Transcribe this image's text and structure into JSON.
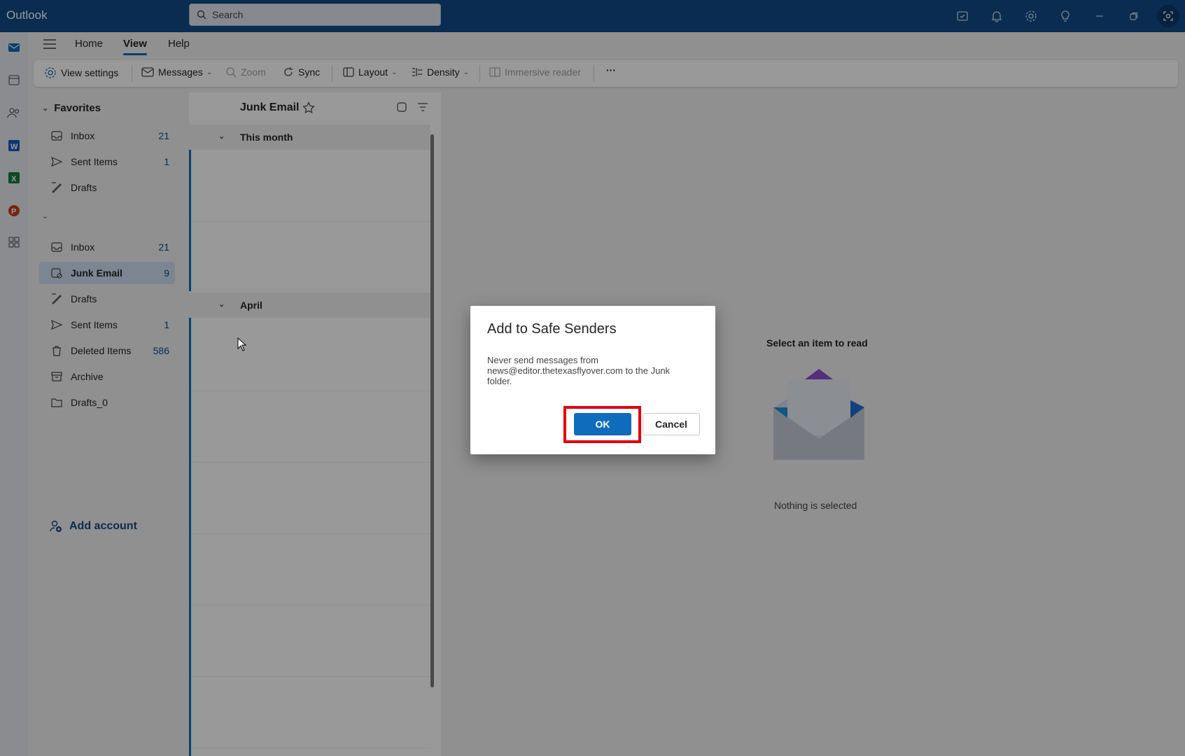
{
  "titlebar": {
    "app_name": "Outlook",
    "search_placeholder": "Search",
    "icons": [
      "my-day-icon",
      "bell-icon",
      "gear-icon",
      "lightbulb-icon",
      "minimize-icon",
      "restore-icon",
      "screen-capture-icon"
    ]
  },
  "rail": {
    "icons": [
      "mail-icon",
      "calendar-icon",
      "people-icon",
      "word-icon",
      "excel-icon",
      "powerpoint-icon",
      "apps-icon"
    ]
  },
  "tabs": [
    {
      "label": "Home"
    },
    {
      "label": "View"
    },
    {
      "label": "Help"
    }
  ],
  "ribbon": {
    "view_settings": "View settings",
    "messages": "Messages",
    "zoom": "Zoom",
    "sync": "Sync",
    "layout": "Layout",
    "density": "Density",
    "immersive_reader": "Immersive reader",
    "more": "···"
  },
  "folders": {
    "favorites_label": "Favorites",
    "favorites": [
      {
        "label": "Inbox",
        "count": "21"
      },
      {
        "label": "Sent Items",
        "count": "1"
      },
      {
        "label": "Drafts",
        "count": ""
      }
    ],
    "account": [
      {
        "label": "Inbox",
        "count": "21"
      },
      {
        "label": "Junk Email",
        "count": "9"
      },
      {
        "label": "Drafts",
        "count": ""
      },
      {
        "label": "Sent Items",
        "count": "1"
      },
      {
        "label": "Deleted Items",
        "count": "586"
      },
      {
        "label": "Archive",
        "count": ""
      },
      {
        "label": "Drafts_0",
        "count": ""
      }
    ],
    "add_account": "Add account"
  },
  "message_list": {
    "title": "Junk Email",
    "groups": [
      {
        "label": "This month"
      },
      {
        "label": "April"
      }
    ]
  },
  "reading_pane": {
    "title": "Select an item to read",
    "empty": "Nothing is selected"
  },
  "dialog": {
    "title": "Add to Safe Senders",
    "body": "Never send messages from news@editor.thetexasflyover.com to the Junk folder.",
    "ok": "OK",
    "cancel": "Cancel"
  },
  "colors": {
    "titlebar": "#0f4a86",
    "accent": "#0f6cbd",
    "highlight": "#e3000f"
  }
}
